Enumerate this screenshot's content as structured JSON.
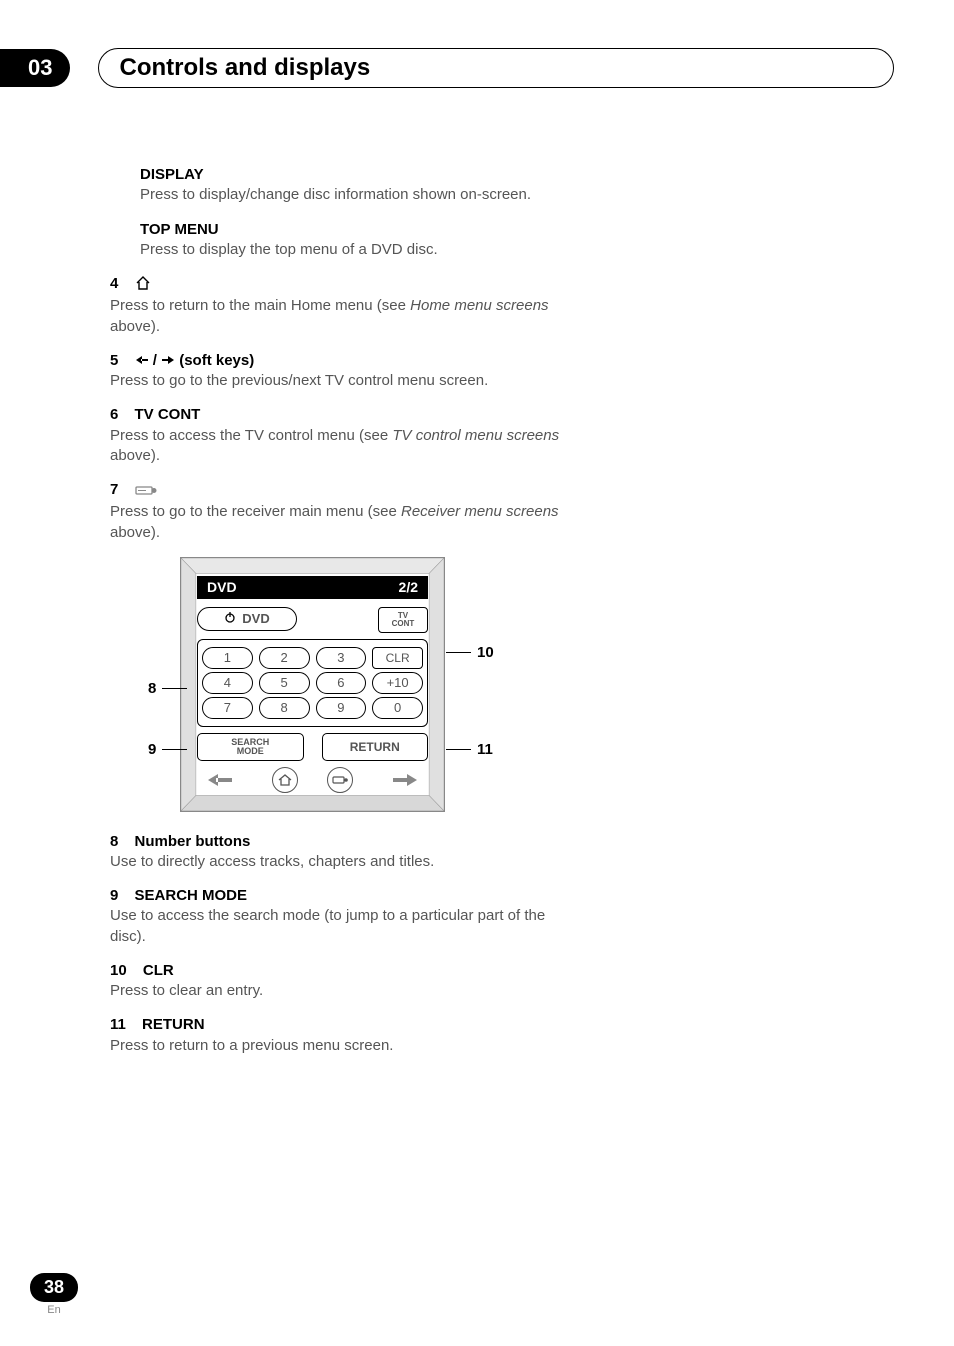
{
  "header": {
    "chapter_num": "03",
    "chapter_title": "Controls and displays"
  },
  "items": {
    "display": {
      "label": "DISPLAY",
      "desc": "Press to display/change disc information shown on-screen."
    },
    "topmenu": {
      "label": "TOP MENU",
      "desc": "Press to display the top menu of a DVD disc."
    },
    "i4": {
      "num": "4",
      "desc_a": "Press to return to the main Home menu (see ",
      "desc_i": "Home menu screens",
      "desc_b": " above)."
    },
    "i5": {
      "num": "5",
      "label": " (soft keys)",
      "desc": "Press to go to the previous/next TV control menu screen."
    },
    "i6": {
      "num": "6",
      "label": "TV CONT",
      "desc_a": "Press to access the TV control menu (see ",
      "desc_i": "TV control menu screens",
      "desc_b": " above)."
    },
    "i7": {
      "num": "7",
      "desc_a": "Press to go to the receiver main menu (see ",
      "desc_i": "Receiver menu screens",
      "desc_b": " above)."
    },
    "i8": {
      "num": "8",
      "label": "Number buttons",
      "desc": "Use to directly access tracks, chapters and titles."
    },
    "i9": {
      "num": "9",
      "label": "SEARCH MODE",
      "desc": "Use to access the search mode (to jump to a particular part of the disc)."
    },
    "i10": {
      "num": "10",
      "label": "CLR",
      "desc": "Press to clear an entry."
    },
    "i11": {
      "num": "11",
      "label": "RETURN",
      "desc": "Press to return to a previous menu screen."
    }
  },
  "diagram": {
    "bar_left": "DVD",
    "bar_right": "2/2",
    "dvd_btn": "DVD",
    "tvcont_btn": "TV\nCONT",
    "nums": {
      "b1": "1",
      "b2": "2",
      "b3": "3",
      "b4": "4",
      "b5": "5",
      "b6": "6",
      "b7": "7",
      "b8": "8",
      "b9": "9",
      "b0": "0",
      "b10": "+10"
    },
    "clr": "CLR",
    "search": "SEARCH\nMODE",
    "ret": "RETURN",
    "callouts": {
      "c8": "8",
      "c9": "9",
      "c10": "10",
      "c11": "11"
    }
  },
  "footer": {
    "page": "38",
    "lang": "En"
  }
}
